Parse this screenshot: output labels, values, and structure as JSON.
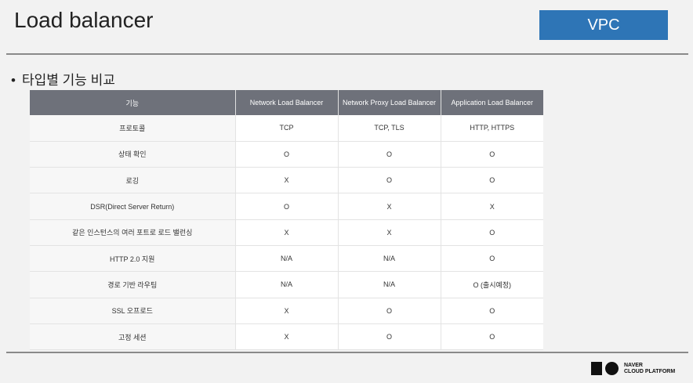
{
  "header": {
    "title": "Load balancer",
    "badge": "VPC"
  },
  "section": {
    "bullet": "•",
    "heading": "타입별 기능 비교"
  },
  "table": {
    "columns": [
      "기능",
      "Network Load Balancer",
      "Network Proxy Load Balancer",
      "Application Load Balancer"
    ],
    "rows": [
      [
        "프로토콜",
        "TCP",
        "TCP, TLS",
        "HTTP, HTTPS"
      ],
      [
        "상태 확인",
        "O",
        "O",
        "O"
      ],
      [
        "로깅",
        "X",
        "O",
        "O"
      ],
      [
        "DSR(Direct Server Return)",
        "O",
        "X",
        "X"
      ],
      [
        "같은 인스턴스의 여러 포트로 로드 밸런싱",
        "X",
        "X",
        "O"
      ],
      [
        "HTTP 2.0 지원",
        "N/A",
        "N/A",
        "O"
      ],
      [
        "경로 기반 라우팅",
        "N/A",
        "N/A",
        "O (출시예정)"
      ],
      [
        "SSL 오프로드",
        "X",
        "O",
        "O"
      ],
      [
        "고정 세션",
        "X",
        "O",
        "O"
      ]
    ]
  },
  "footer": {
    "logo_line1": "NAVER",
    "logo_line2": "CLOUD PLATFORM"
  }
}
